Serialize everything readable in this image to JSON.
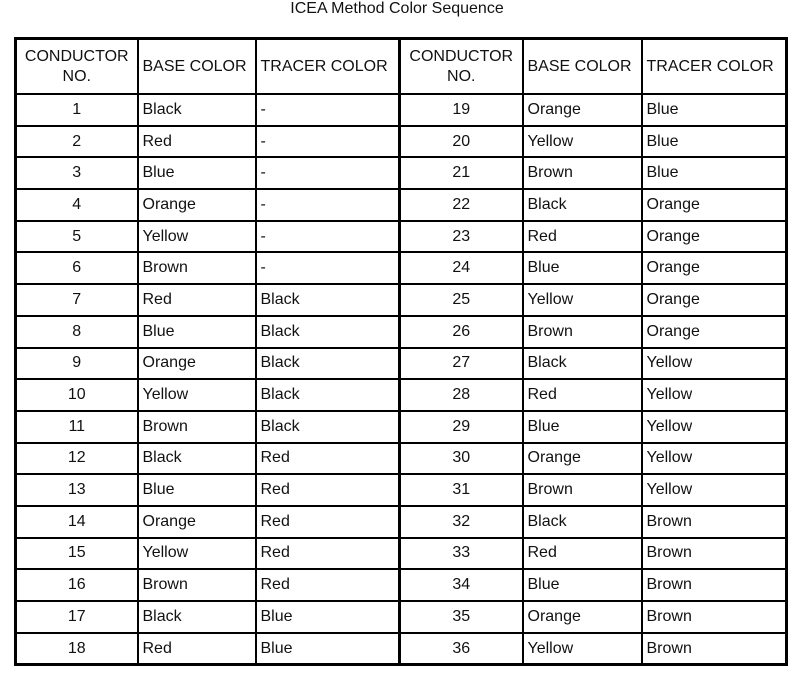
{
  "title": "ICEA Method Color Sequence",
  "headers": {
    "conductor_no": "CONDUCTOR NO.",
    "base_color": "BASE COLOR",
    "tracer_color": "TRACER COLOR"
  },
  "rows": [
    {
      "left": {
        "no": "1",
        "base": "Black",
        "tracer": "-"
      },
      "right": {
        "no": "19",
        "base": "Orange",
        "tracer": "Blue"
      }
    },
    {
      "left": {
        "no": "2",
        "base": "Red",
        "tracer": "-"
      },
      "right": {
        "no": "20",
        "base": "Yellow",
        "tracer": "Blue"
      }
    },
    {
      "left": {
        "no": "3",
        "base": "Blue",
        "tracer": "-"
      },
      "right": {
        "no": "21",
        "base": "Brown",
        "tracer": "Blue"
      }
    },
    {
      "left": {
        "no": "4",
        "base": "Orange",
        "tracer": "-"
      },
      "right": {
        "no": "22",
        "base": "Black",
        "tracer": "Orange"
      }
    },
    {
      "left": {
        "no": "5",
        "base": "Yellow",
        "tracer": "-"
      },
      "right": {
        "no": "23",
        "base": "Red",
        "tracer": "Orange"
      }
    },
    {
      "left": {
        "no": "6",
        "base": "Brown",
        "tracer": "-"
      },
      "right": {
        "no": "24",
        "base": "Blue",
        "tracer": "Orange"
      }
    },
    {
      "left": {
        "no": "7",
        "base": "Red",
        "tracer": "Black"
      },
      "right": {
        "no": "25",
        "base": "Yellow",
        "tracer": "Orange"
      }
    },
    {
      "left": {
        "no": "8",
        "base": "Blue",
        "tracer": "Black"
      },
      "right": {
        "no": "26",
        "base": "Brown",
        "tracer": "Orange"
      }
    },
    {
      "left": {
        "no": "9",
        "base": "Orange",
        "tracer": "Black"
      },
      "right": {
        "no": "27",
        "base": "Black",
        "tracer": "Yellow"
      }
    },
    {
      "left": {
        "no": "10",
        "base": "Yellow",
        "tracer": "Black"
      },
      "right": {
        "no": "28",
        "base": "Red",
        "tracer": "Yellow"
      }
    },
    {
      "left": {
        "no": "11",
        "base": "Brown",
        "tracer": "Black"
      },
      "right": {
        "no": "29",
        "base": "Blue",
        "tracer": "Yellow"
      }
    },
    {
      "left": {
        "no": "12",
        "base": "Black",
        "tracer": "Red"
      },
      "right": {
        "no": "30",
        "base": "Orange",
        "tracer": "Yellow"
      }
    },
    {
      "left": {
        "no": "13",
        "base": "Blue",
        "tracer": "Red"
      },
      "right": {
        "no": "31",
        "base": "Brown",
        "tracer": "Yellow"
      }
    },
    {
      "left": {
        "no": "14",
        "base": "Orange",
        "tracer": "Red"
      },
      "right": {
        "no": "32",
        "base": "Black",
        "tracer": "Brown"
      }
    },
    {
      "left": {
        "no": "15",
        "base": "Yellow",
        "tracer": "Red"
      },
      "right": {
        "no": "33",
        "base": "Red",
        "tracer": "Brown"
      }
    },
    {
      "left": {
        "no": "16",
        "base": "Brown",
        "tracer": "Red"
      },
      "right": {
        "no": "34",
        "base": "Blue",
        "tracer": "Brown"
      }
    },
    {
      "left": {
        "no": "17",
        "base": "Black",
        "tracer": "Blue"
      },
      "right": {
        "no": "35",
        "base": "Orange",
        "tracer": "Brown"
      }
    },
    {
      "left": {
        "no": "18",
        "base": "Red",
        "tracer": "Blue"
      },
      "right": {
        "no": "36",
        "base": "Yellow",
        "tracer": "Brown"
      }
    }
  ]
}
